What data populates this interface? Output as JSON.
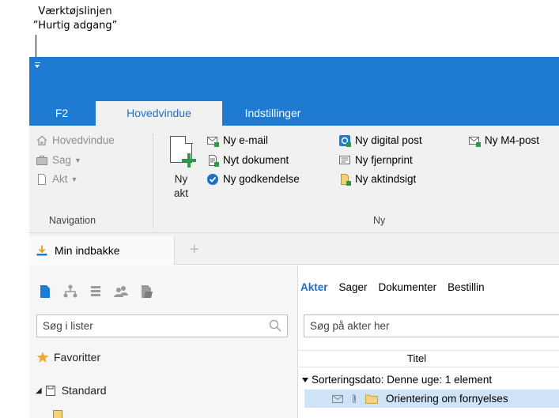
{
  "callout": {
    "line1": "Værktøjslinjen",
    "line2": "”Hurtig adgang”"
  },
  "tabs": {
    "f2": "F2",
    "main": "Hovedvindue",
    "settings": "Indstillinger"
  },
  "ribbon": {
    "navigation": {
      "main": "Hovedvindue",
      "sag": "Sag",
      "akt": "Akt",
      "label": "Navigation"
    },
    "ny": {
      "big_line1": "Ny",
      "big_line2": "akt",
      "email": "Ny e-mail",
      "document": "Nyt dokument",
      "approval": "Ny godkendelse",
      "digital_post": "Ny digital post",
      "remote_print": "Ny fjernprint",
      "access_request": "Ny aktindsigt",
      "m4_post": "Ny M4-post",
      "label": "Ny"
    }
  },
  "doc_tabs": {
    "inbox": "Min indbakke",
    "add": "+"
  },
  "left_panel": {
    "search_placeholder": "Søg i lister",
    "favorites": "Favoritter",
    "standard": "Standard"
  },
  "right_panel": {
    "tabs": [
      "Akter",
      "Sager",
      "Dokumenter",
      "Bestillin"
    ],
    "search_placeholder": "Søg på akter her",
    "column_title": "Titel",
    "group_label": "Sorteringsdato: Denne uge: 1 element",
    "row_title": "Orientering om fornyelses"
  },
  "colors": {
    "accent": "#1e7bd1",
    "selection": "#cfe3f7",
    "green": "#2e9a44"
  }
}
